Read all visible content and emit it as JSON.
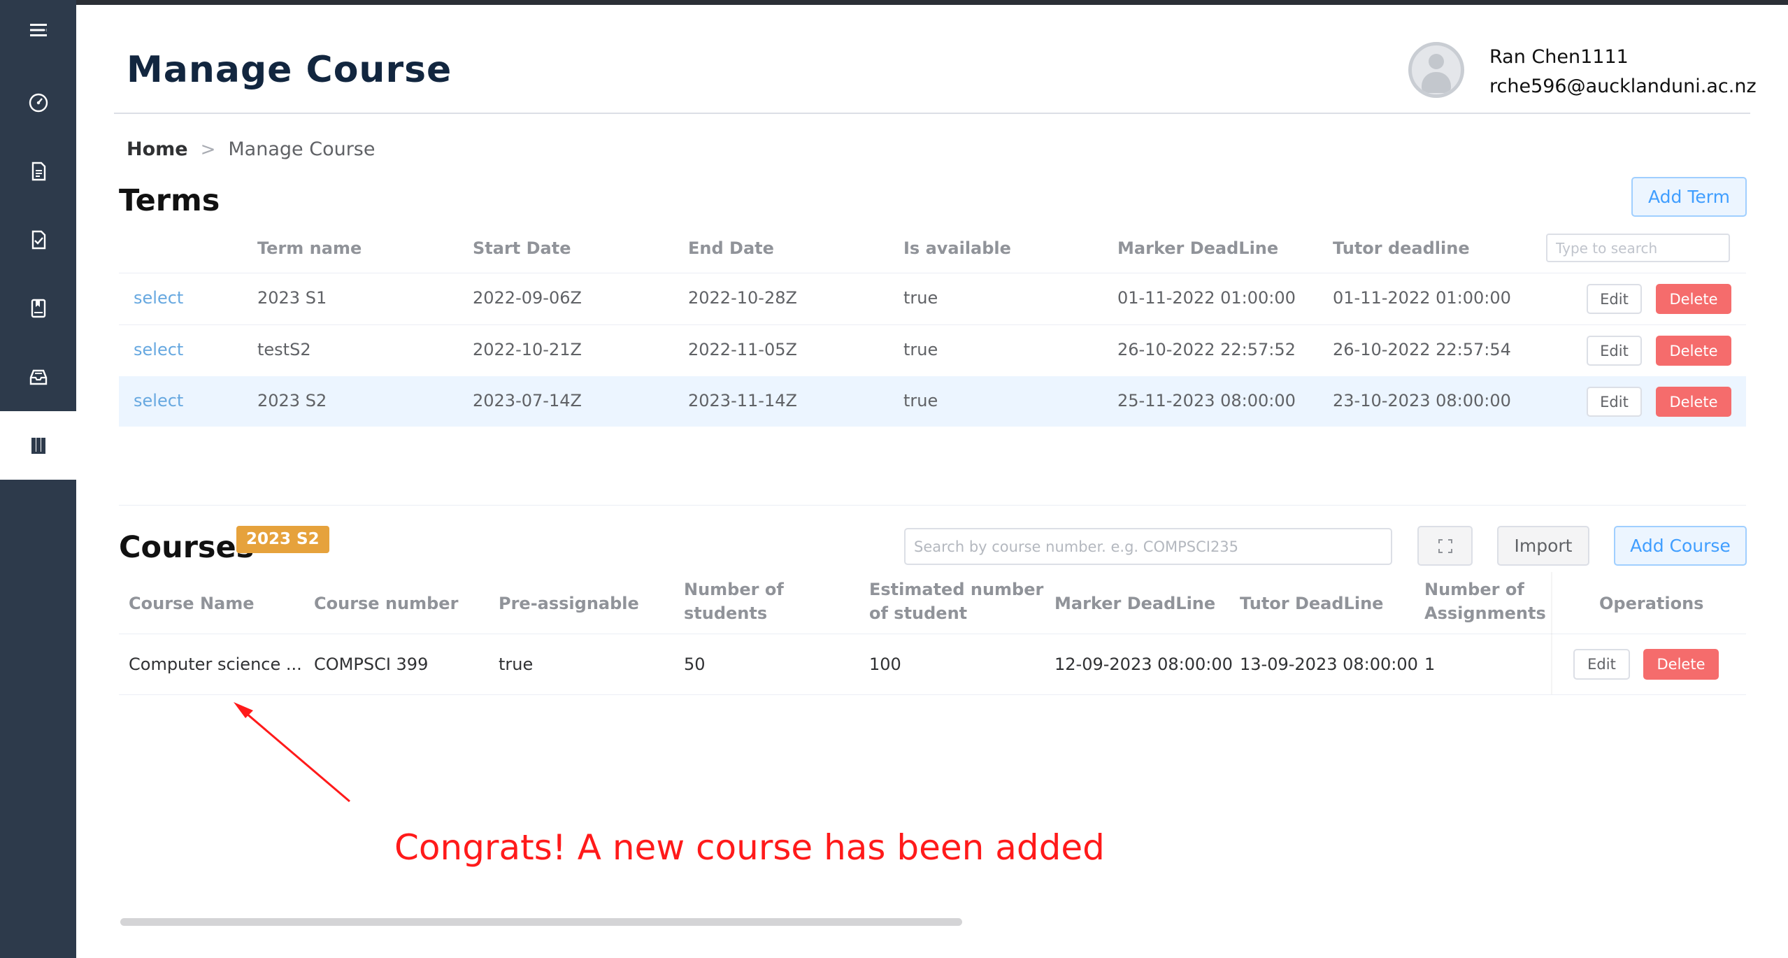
{
  "sidebar": {
    "items": [
      {
        "icon": "menu-icon"
      },
      {
        "icon": "dashboard-icon"
      },
      {
        "icon": "document-icon"
      },
      {
        "icon": "checklist-icon"
      },
      {
        "icon": "bookmark-icon"
      },
      {
        "icon": "inbox-icon"
      },
      {
        "icon": "books-icon",
        "active": true
      }
    ]
  },
  "header": {
    "title": "Manage Course",
    "user_name": "Ran Chen1111",
    "user_email": "rche596@aucklanduni.ac.nz"
  },
  "breadcrumb": {
    "home": "Home",
    "separator": ">",
    "current": "Manage Course"
  },
  "terms": {
    "title": "Terms",
    "add_button": "Add Term",
    "search_placeholder": "Type to search",
    "columns": [
      "Term name",
      "Start Date",
      "End Date",
      "Is available",
      "Marker DeadLine",
      "Tutor deadline"
    ],
    "select_label": "select",
    "edit_label": "Edit",
    "delete_label": "Delete",
    "rows": [
      {
        "name": "2023 S1",
        "start": "2022-09-06Z",
        "end": "2022-10-28Z",
        "available": "true",
        "marker": "01-11-2022 01:00:00",
        "tutor": "01-11-2022 01:00:00"
      },
      {
        "name": "testS2",
        "start": "2022-10-21Z",
        "end": "2022-11-05Z",
        "available": "true",
        "marker": "26-10-2022 22:57:52",
        "tutor": "26-10-2022 22:57:54"
      },
      {
        "name": "2023 S2",
        "start": "2023-07-14Z",
        "end": "2023-11-14Z",
        "available": "true",
        "marker": "25-11-2023 08:00:00",
        "tutor": "23-10-2023 08:00:00",
        "highlighted": true
      }
    ]
  },
  "courses": {
    "title": "Courses",
    "term_tag": "2023 S2",
    "search_placeholder": "Search by course number. e.g. COMPSCI235",
    "import_button": "Import",
    "add_button": "Add Course",
    "columns": {
      "name": "Course Name",
      "number": "Course number",
      "preassign": "Pre-assignable",
      "students_1": "Number of",
      "students_2": "students",
      "estimated_1": "Estimated number",
      "estimated_2": "of student",
      "marker": "Marker DeadLine",
      "tutor": "Tutor DeadLine",
      "assignments_1": "Number of",
      "assignments_2": "Assignments",
      "operations": "Operations"
    },
    "edit_label": "Edit",
    "delete_label": "Delete",
    "rows": [
      {
        "name": "Computer science ...",
        "number": "COMPSCI 399",
        "preassign": "true",
        "students": "50",
        "estimated": "100",
        "marker": "12-09-2023 08:00:00",
        "tutor": "13-09-2023 08:00:00",
        "assignments": "1"
      }
    ]
  },
  "annotation": {
    "text": "Congrats! A new course has been added",
    "color": "#ff1a1a"
  },
  "colors": {
    "sidebar": "#2d3a4b",
    "primary": "#409eff",
    "danger": "#f56c6c",
    "warning_tag": "#e6a23c",
    "title": "#12263f"
  }
}
